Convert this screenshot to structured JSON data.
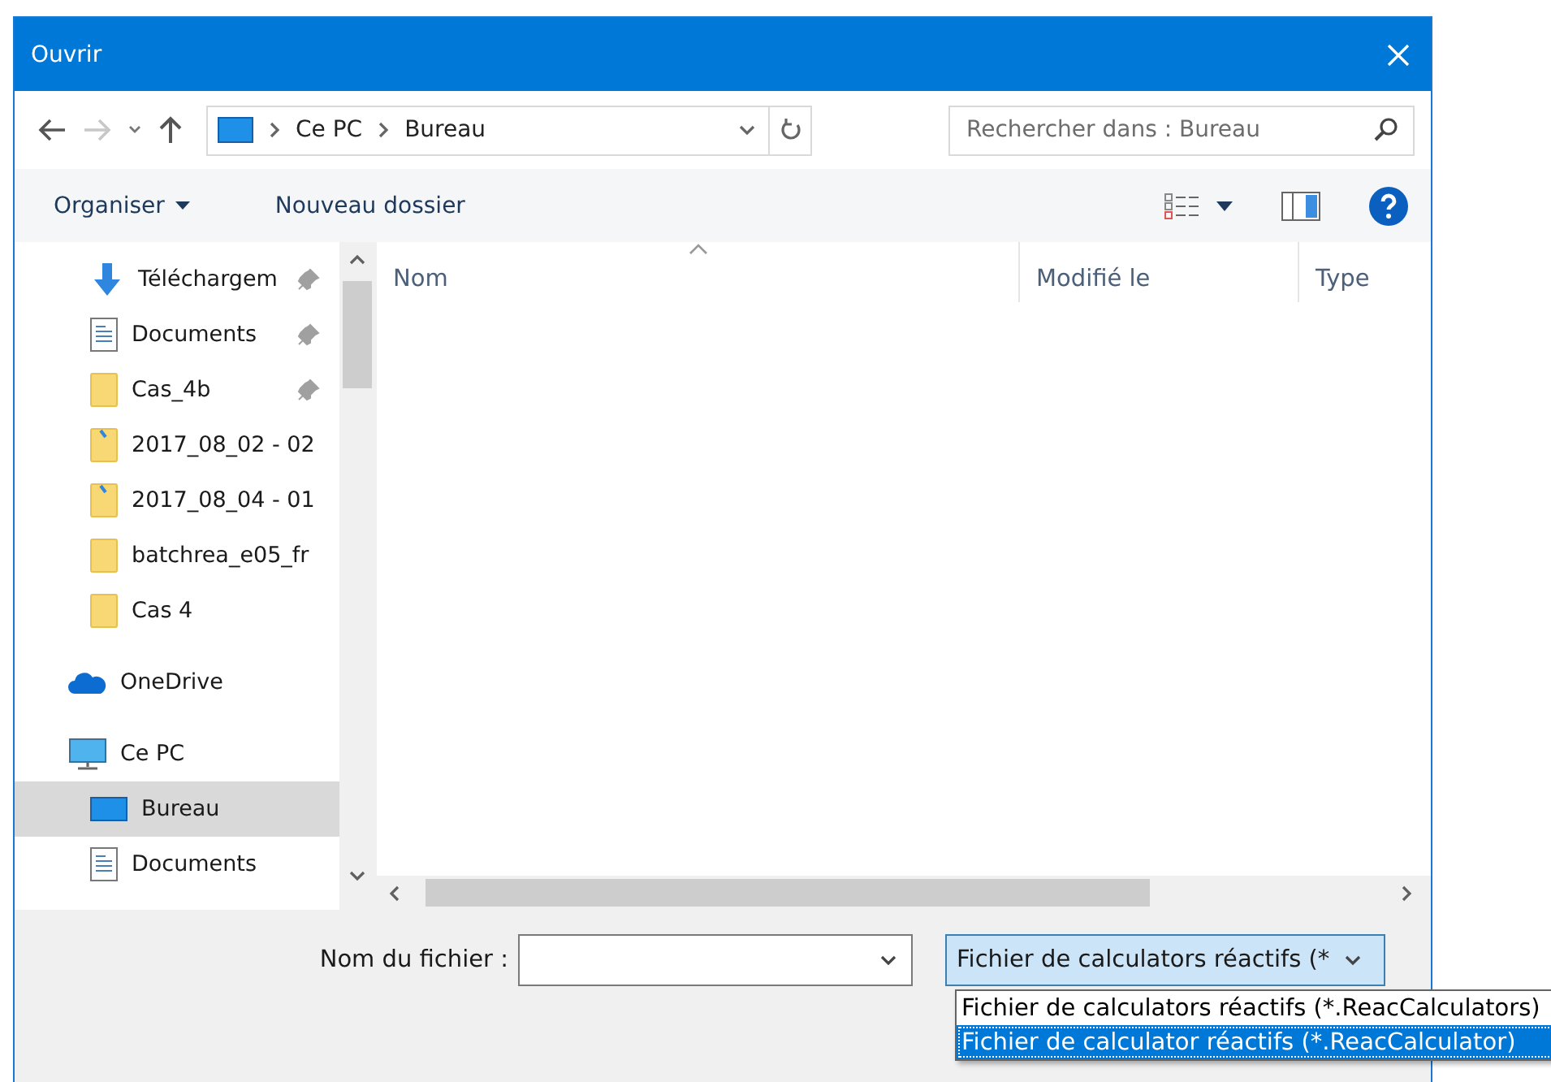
{
  "window": {
    "title": "Ouvrir"
  },
  "nav": {
    "breadcrumb": [
      "Ce PC",
      "Bureau"
    ],
    "search_placeholder": "Rechercher dans : Bureau"
  },
  "toolbar": {
    "buttons": [
      {
        "label": "Organiser",
        "kind": "menu"
      },
      {
        "label": "Nouveau dossier",
        "kind": "plain"
      }
    ]
  },
  "sidebar": {
    "quick_access": [
      {
        "label": "Téléchargem",
        "kind": "download",
        "pinned": true,
        "selected": false
      },
      {
        "label": "Documents",
        "kind": "document",
        "pinned": true,
        "selected": false
      },
      {
        "label": "Cas_4b",
        "kind": "folder",
        "pinned": true,
        "selected": false
      },
      {
        "label": "2017_08_02 - 02",
        "kind": "shortcut",
        "pinned": false,
        "selected": false
      },
      {
        "label": "2017_08_04 - 01",
        "kind": "shortcut",
        "pinned": false,
        "selected": false
      },
      {
        "label": "batchrea_e05_fr",
        "kind": "folder",
        "pinned": false,
        "selected": false
      },
      {
        "label": "Cas 4",
        "kind": "folder",
        "pinned": false,
        "selected": false
      }
    ],
    "items": [
      {
        "label": "OneDrive",
        "kind": "cloud",
        "selected": false
      },
      {
        "label": "Ce PC",
        "kind": "computer",
        "selected": false,
        "children": [
          {
            "label": "Bureau",
            "kind": "desktop",
            "selected": true
          },
          {
            "label": "Documents",
            "kind": "document",
            "selected": false
          }
        ]
      }
    ]
  },
  "table": {
    "columns": [
      {
        "label": "Nom",
        "sorted": true
      },
      {
        "label": "Modifié le",
        "sorted": false
      },
      {
        "label": "Type",
        "sorted": false
      }
    ]
  },
  "filename": {
    "label": "Nom du fichier :"
  },
  "filetype": {
    "value": "Fichier de calculators réactifs (*",
    "expanded": true,
    "options": [
      {
        "label": "Fichier de calculators réactifs (*.ReacCalculators)",
        "selected": false
      },
      {
        "label": "Fichier de calculator réactifs (*.ReacCalculator)",
        "selected": true
      }
    ]
  }
}
